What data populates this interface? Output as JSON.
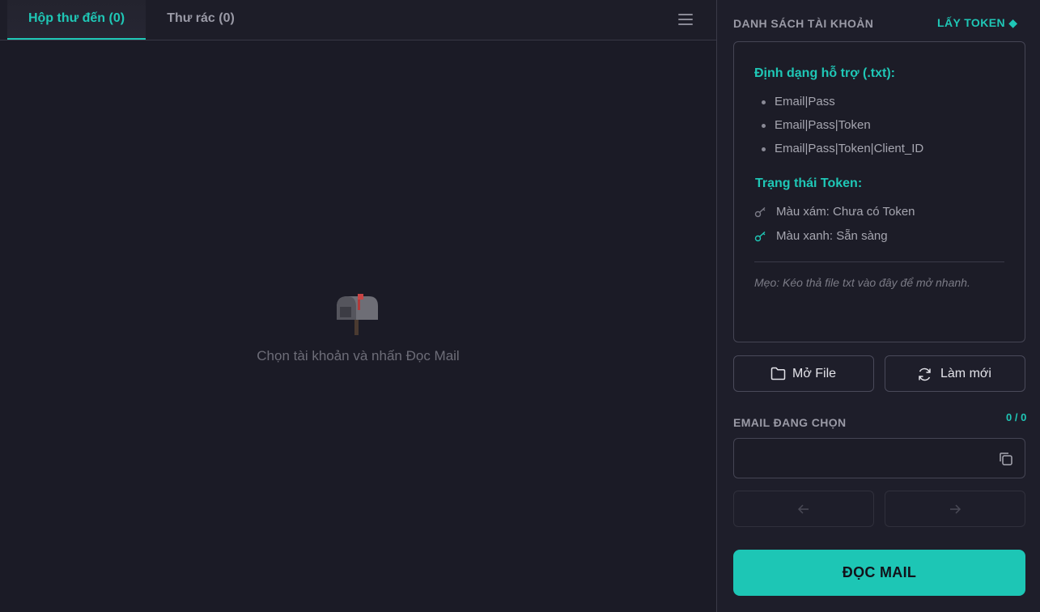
{
  "tabs": {
    "inbox_label": "Hộp thư đến (0)",
    "spam_label": "Thư rác (0)"
  },
  "empty_state": {
    "icon": "mailbox-icon",
    "message": "Chọn tài khoản và nhấn Đọc Mail"
  },
  "accounts": {
    "title": "DANH SÁCH TÀI KHOẢN",
    "get_token_label": "LẤY TOKEN ◆",
    "formats_heading": "Định dạng hỗ trợ (.txt):",
    "formats": [
      "Email|Pass",
      "Email|Pass|Token",
      "Email|Pass|Token|Client_ID"
    ],
    "token_status_heading": "Trạng thái Token:",
    "status_gray": "Màu xám: Chưa có Token",
    "status_green": "Màu xanh: Sẵn sàng",
    "tip": "Mẹo: Kéo thả file txt vào đây để mở nhanh."
  },
  "buttons": {
    "open_file": "Mở File",
    "refresh": "Làm mới",
    "read_mail": "ĐỌC MAIL"
  },
  "selected_email": {
    "title": "EMAIL ĐANG CHỌN",
    "counter": "0 / 0",
    "value": "",
    "placeholder": ""
  },
  "colors": {
    "accent": "#1fc7b6",
    "background": "#1b1b26",
    "panel": "#1e1e2a"
  }
}
